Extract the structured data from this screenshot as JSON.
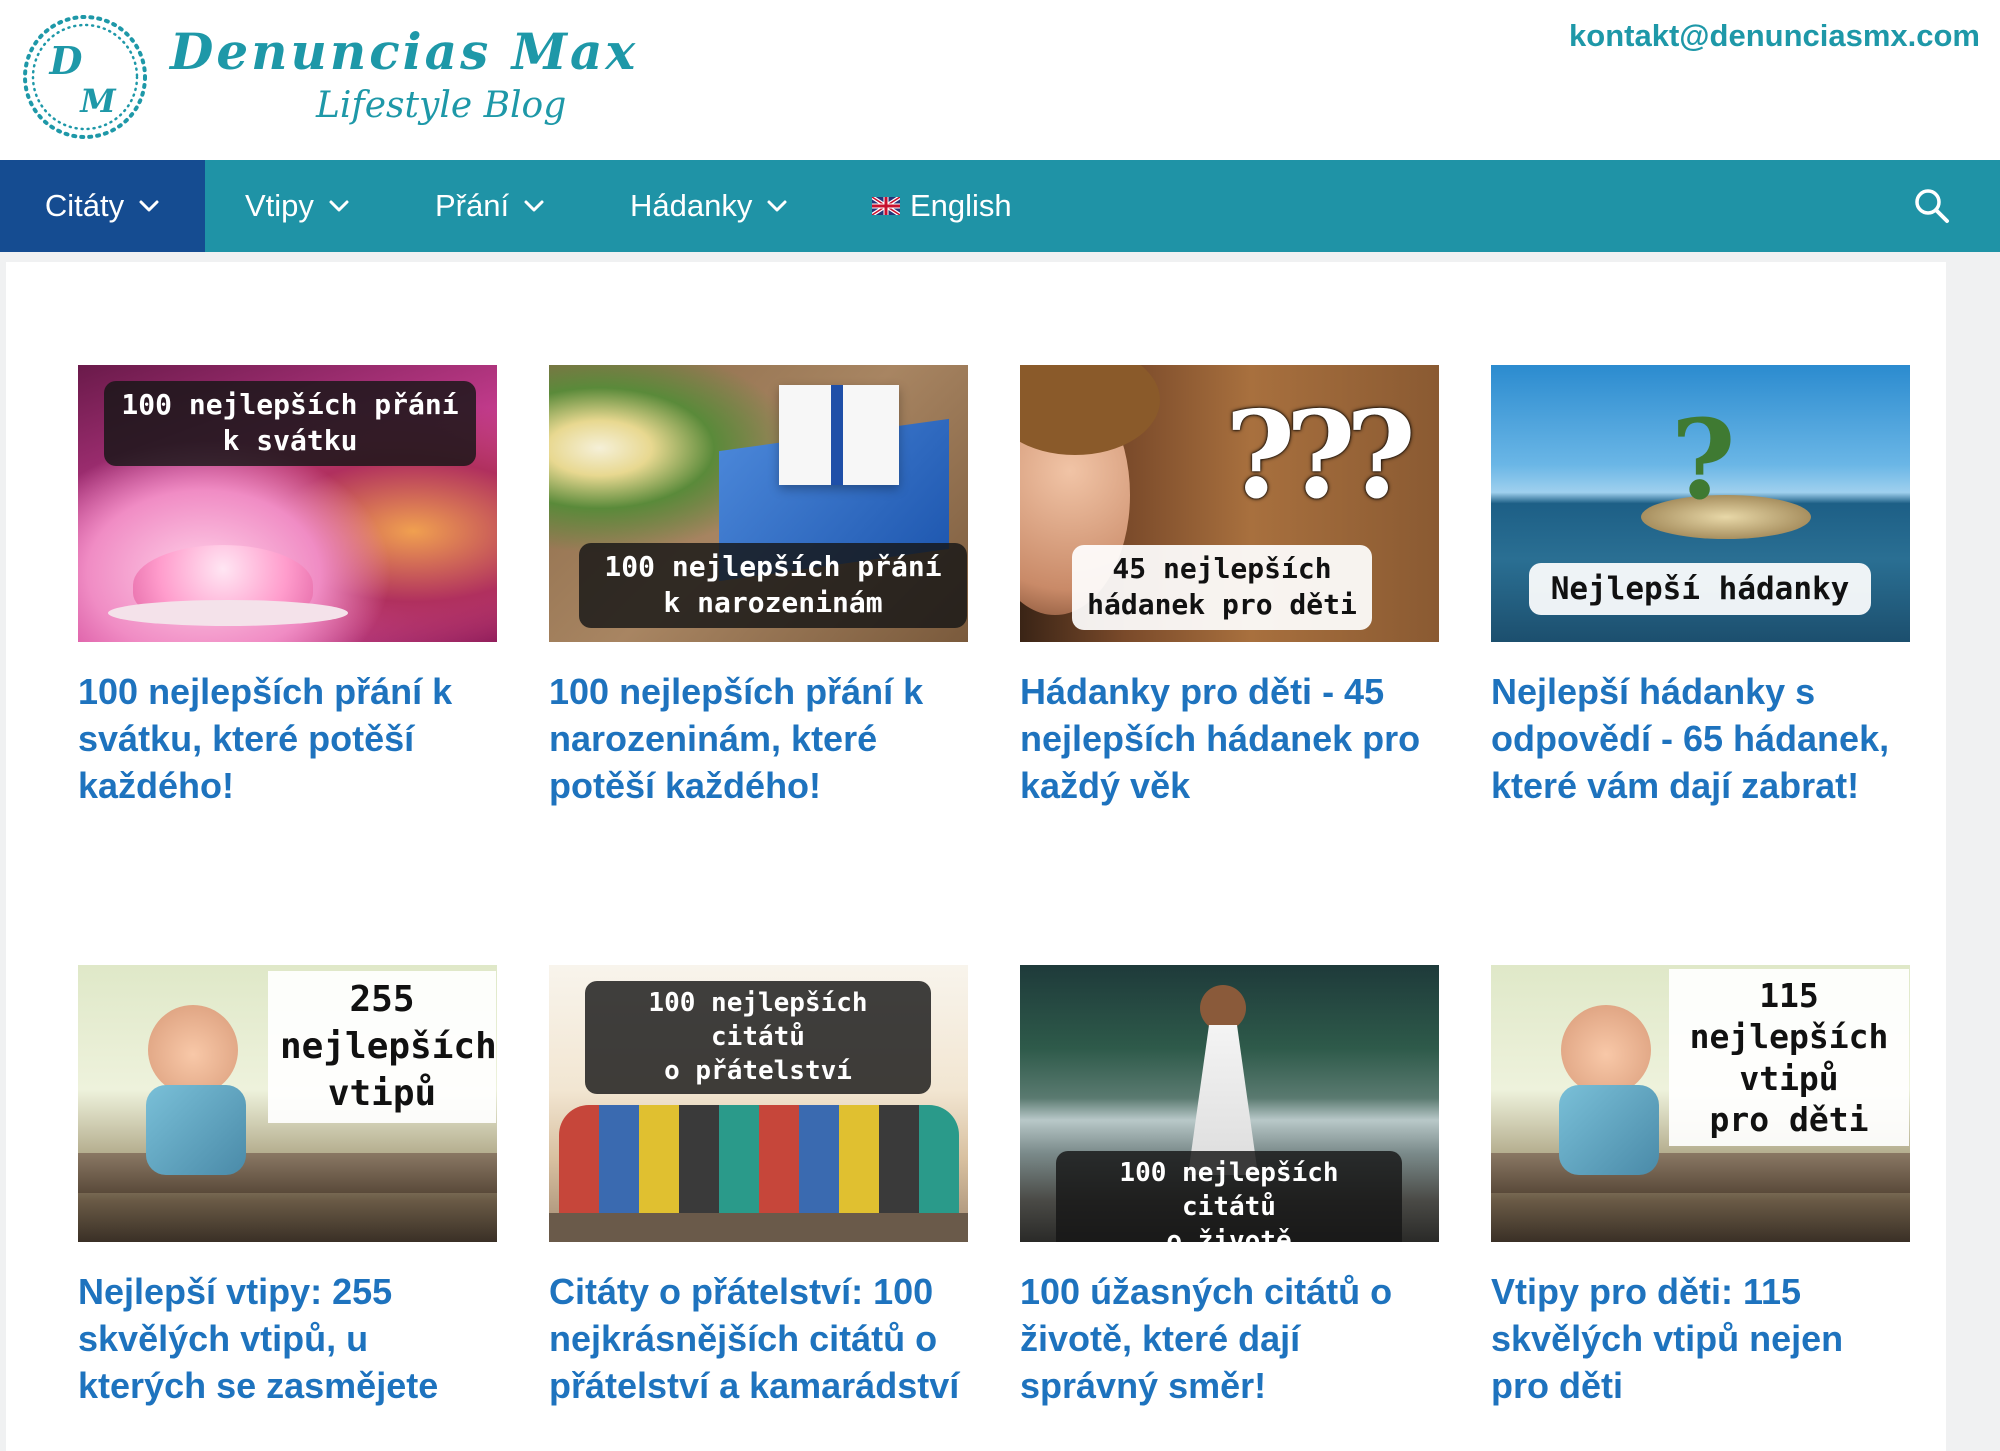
{
  "header": {
    "logo_letters": [
      "D",
      "M"
    ],
    "brand_name": "Denuncias Max",
    "tagline": "Lifestyle Blog",
    "contact_email": "kontakt@denunciasmx.com"
  },
  "nav": {
    "items": [
      {
        "label": "Citáty",
        "has_dropdown": true,
        "active": true
      },
      {
        "label": "Vtipy",
        "has_dropdown": true
      },
      {
        "label": "Přání",
        "has_dropdown": true
      },
      {
        "label": "Hádanky",
        "has_dropdown": true
      },
      {
        "label": "English",
        "icon": "uk-flag-icon"
      }
    ],
    "search_icon": "search-icon"
  },
  "colors": {
    "brand": "#1e98a8",
    "nav_bg": "#1f93a6",
    "nav_active": "#154c91",
    "title_link": "#1e73be"
  },
  "posts": [
    {
      "thumb_lines": [
        "100 nejlepších přání",
        "k svátku"
      ],
      "title": "100 nejlepších přání k svátku, které potěší každého!"
    },
    {
      "thumb_lines": [
        "100 nejlepších přání",
        "k narozeninám"
      ],
      "title": "100 nejlepších přání k narozeninám, které potěší každého!"
    },
    {
      "thumb_lines": [
        "45 nejlepších",
        "hádanek pro děti"
      ],
      "thumb_extra": "???",
      "title": "Hádanky pro děti - 45 nejlepších hádanek pro každý věk"
    },
    {
      "thumb_lines": [
        "Nejlepší hádanky"
      ],
      "thumb_extra": "?",
      "title": "Nejlepší hádanky s odpovědí - 65 hádanek, které vám dají zabrat!"
    },
    {
      "thumb_lines": [
        "255",
        "nejlepších",
        "vtipů"
      ],
      "title": "Nejlepší vtipy: 255 skvělých vtipů, u kterých se zasmějete"
    },
    {
      "thumb_lines": [
        "100 nejlepších citátů",
        "o přátelství"
      ],
      "title": "Citáty o přátelství: 100 nejkrásnějších citátů o přátelství a kamarádství"
    },
    {
      "thumb_lines": [
        "100 nejlepších citátů",
        "o životě"
      ],
      "title": "100 úžasných citátů o životě, které dají správný směr!"
    },
    {
      "thumb_lines": [
        "115",
        "nejlepších",
        "vtipů",
        "pro děti"
      ],
      "title": "Vtipy pro děti: 115 skvělých vtipů nejen pro děti"
    }
  ]
}
